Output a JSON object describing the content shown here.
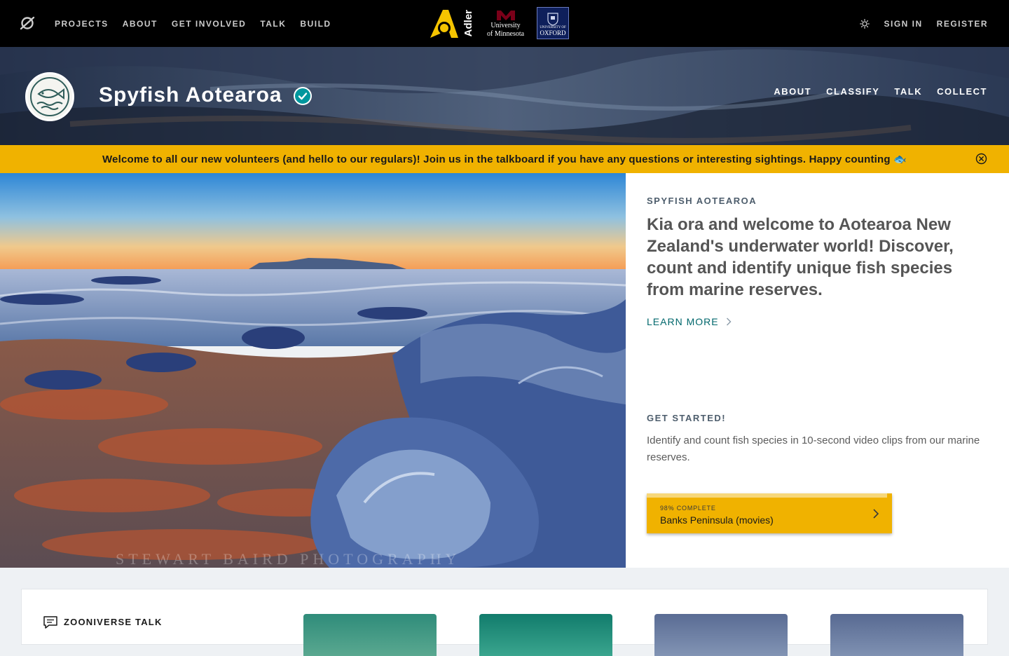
{
  "topbar": {
    "logo_icon": "zooniverse-logo-icon",
    "nav": [
      "PROJECTS",
      "ABOUT",
      "GET INVOLVED",
      "TALK",
      "BUILD"
    ],
    "partners": {
      "adler": "Adler",
      "umn_line1": "University",
      "umn_line2": "of Minnesota",
      "oxford_small": "UNIVERSITY OF",
      "oxford": "OXFORD"
    },
    "theme_icon": "sun-icon",
    "sign_in": "SIGN IN",
    "register": "REGISTER"
  },
  "project": {
    "title": "Spyfish Aotearoa",
    "verified_icon": "check-circle-icon",
    "nav": [
      "ABOUT",
      "CLASSIFY",
      "TALK",
      "COLLECT"
    ]
  },
  "announcement": {
    "text": "Welcome to all our new volunteers (and hello to our regulars)! Join us in the talkboard if you have any questions or interesting sightings. Happy counting 🐟",
    "close_icon": "close-circle-icon"
  },
  "hero": {
    "watermark": "STEWART BAIRD PHOTOGRAPHY",
    "label": "SPYFISH AOTEAROA",
    "description": "Kia ora and welcome to Aotearoa New Zealand's underwater world! Discover, count and identify unique fish species from marine reserves.",
    "learn_more": "LEARN MORE",
    "get_started": "GET STARTED!",
    "get_started_desc": "Identify and count fish species in 10-second video clips from our marine reserves.",
    "workflow": {
      "progress_label": "98% COMPLETE",
      "progress": 0.98,
      "name": "Banks Peninsula (movies)"
    }
  },
  "talk": {
    "title": "ZOONIVERSE TALK",
    "icon": "chat-bubble-icon"
  },
  "colors": {
    "accent_yellow": "#f0b200",
    "teal_link": "#00676c",
    "topbar": "#000000"
  }
}
